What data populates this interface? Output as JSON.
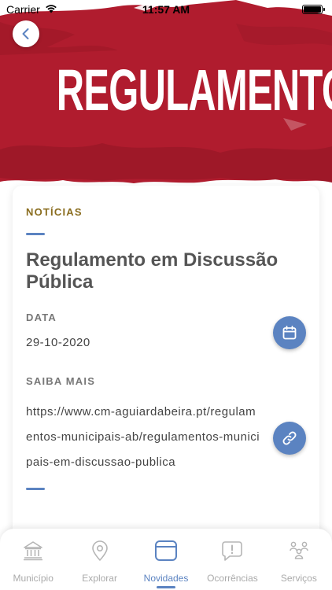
{
  "status_bar": {
    "carrier": "Carrier",
    "time": "11:57 AM"
  },
  "hero": {
    "banner_text": "REGULAMENTO",
    "banner_color": "#b01c2e"
  },
  "article": {
    "category": "NOTÍCIAS",
    "title": "Regulamento em Discussão Pública",
    "date_label": "DATA",
    "date_value": "29-10-2020",
    "link_label": "SAIBA MAIS",
    "link_value": "https://www.cm-aguiardabeira.pt/regulamentos-municipais-ab/regulamentos-municipais-em-discussao-publica"
  },
  "icons": {
    "back": "chevron-left-icon",
    "date_action": "calendar-icon",
    "link_action": "link-icon"
  },
  "tabbar": {
    "tabs": [
      {
        "label": "Município",
        "icon": "building-icon",
        "active": false
      },
      {
        "label": "Explorar",
        "icon": "map-pin-icon",
        "active": false
      },
      {
        "label": "Novidades",
        "icon": "news-icon",
        "active": true
      },
      {
        "label": "Ocorrências",
        "icon": "alert-chat-icon",
        "active": false
      },
      {
        "label": "Serviços",
        "icon": "services-icon",
        "active": false
      }
    ]
  },
  "colors": {
    "accent": "#5b83c1",
    "category": "#8a6d1f"
  }
}
